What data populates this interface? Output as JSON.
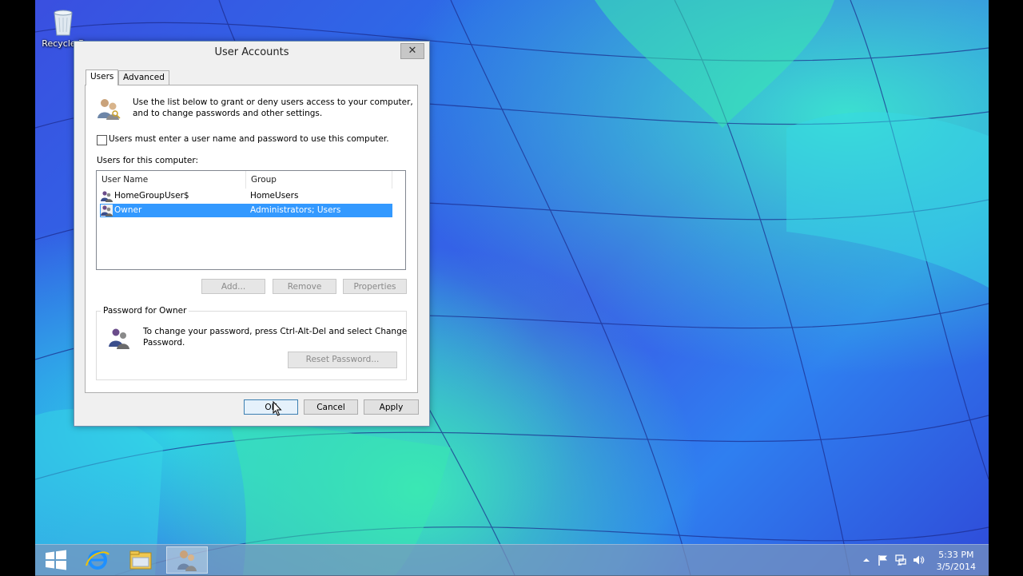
{
  "desktop": {
    "recycle_label": "Recycle B"
  },
  "window": {
    "title": "User Accounts",
    "close_glyph": "✕",
    "tabs": [
      {
        "label": "Users",
        "active": true
      },
      {
        "label": "Advanced",
        "active": false
      }
    ],
    "intro_line1": "Use the list below to grant or deny users access to your computer,",
    "intro_line2": "and to change passwords and other settings.",
    "require_password_label": "Users must enter a user name and password to use this computer.",
    "require_password_checked": false,
    "users_list_label": "Users for this computer:",
    "columns": [
      "User Name",
      "Group"
    ],
    "rows": [
      {
        "name": "HomeGroupUser$",
        "group": "HomeUsers",
        "selected": false
      },
      {
        "name": "Owner",
        "group": "Administrators; Users",
        "selected": true
      }
    ],
    "buttons": {
      "add": "Add...",
      "remove": "Remove",
      "properties": "Properties",
      "reset_password": "Reset Password...",
      "ok": "OK",
      "cancel": "Cancel",
      "apply": "Apply"
    },
    "password_group_label": "Password for Owner",
    "password_text_line1": "To change your password, press Ctrl-Alt-Del and select Change",
    "password_text_line2": "Password."
  },
  "taskbar": {
    "items": [
      "start-icon",
      "internet-explorer-icon",
      "file-explorer-icon",
      "user-accounts-icon"
    ],
    "active_item": "user-accounts-icon",
    "tray_icons": [
      "show-hidden-icons-icon",
      "action-center-flag-icon",
      "network-icon",
      "volume-icon"
    ],
    "clock_time": "5:33 PM",
    "clock_date": "3/5/2014"
  },
  "colors": {
    "selection": "#3399ff",
    "window_bg": "#f0f0f0",
    "taskbar": "#7896be"
  }
}
